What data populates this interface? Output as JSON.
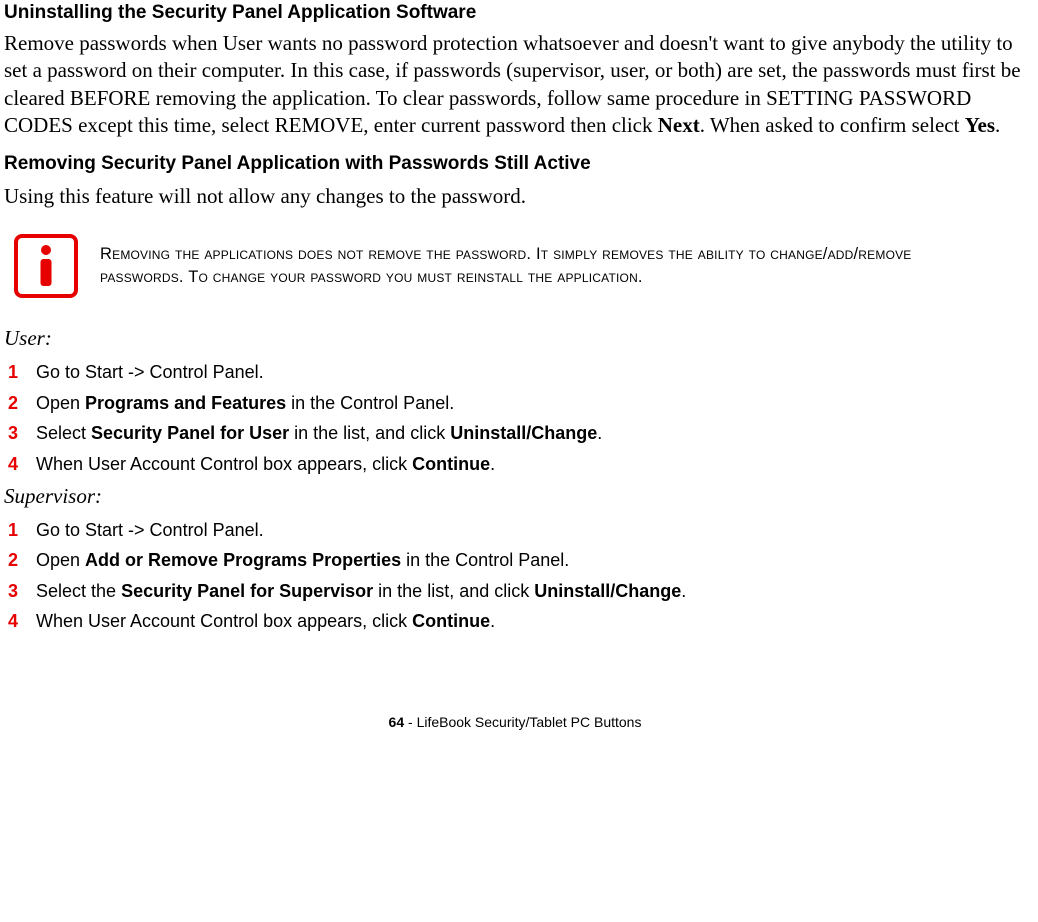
{
  "heading1": "Uninstalling the Security Panel Application Software",
  "para1_pre": "Remove passwords when User wants no password protection whatsoever and doesn't want to give anybody the utility to set a password on their computer. In this case, if passwords (supervisor, user, or both) are set, the passwords must first be cleared BEFORE removing the application. To clear passwords, follow same procedure in SETTING PASSWORD CODES except this time, select REMOVE, enter current password then click ",
  "para1_bold1": "Next",
  "para1_mid": ". When asked to confirm select ",
  "para1_bold2": "Yes",
  "para1_end": ".",
  "heading2": "Removing Security Panel Application with Passwords Still Active",
  "para2": "Using this feature will not allow any changes to the password.",
  "note": "Removing the applications does not remove the password. It simply removes the ability to change/add/remove passwords. To change your password you must reinstall the application.",
  "userLabel": "User:",
  "userSteps": [
    {
      "n": "1",
      "pre": "Go to Start -> Control Panel.",
      "segs": []
    },
    {
      "n": "2",
      "pre": "Open ",
      "segs": [
        {
          "b": "Programs and Features"
        },
        {
          "t": " in the Control Panel."
        }
      ]
    },
    {
      "n": "3",
      "pre": "Select ",
      "segs": [
        {
          "b": "Security Panel for User"
        },
        {
          "t": " in the list, and click "
        },
        {
          "b": "Uninstall/Change"
        },
        {
          "t": "."
        }
      ]
    },
    {
      "n": "4",
      "pre": "When User Account Control box appears, click ",
      "segs": [
        {
          "b": "Continue"
        },
        {
          "t": "."
        }
      ]
    }
  ],
  "supLabel": "Supervisor:",
  "supSteps": [
    {
      "n": "1",
      "pre": "Go to Start -> Control Panel.",
      "segs": []
    },
    {
      "n": "2",
      "pre": "Open ",
      "segs": [
        {
          "b": "Add or Remove Programs Properties"
        },
        {
          "t": " in the Control Panel."
        }
      ]
    },
    {
      "n": "3",
      "pre": "Select the ",
      "segs": [
        {
          "b": "Security Panel for Supervisor"
        },
        {
          "t": " in the list, and click "
        },
        {
          "b": "Uninstall/Change"
        },
        {
          "t": "."
        }
      ]
    },
    {
      "n": "4",
      "pre": "When User Account Control box appears, click ",
      "segs": [
        {
          "b": "Continue"
        },
        {
          "t": "."
        }
      ]
    }
  ],
  "footer": {
    "page": "64",
    "sep": " - ",
    "title": "LifeBook Security/Tablet PC Buttons"
  }
}
